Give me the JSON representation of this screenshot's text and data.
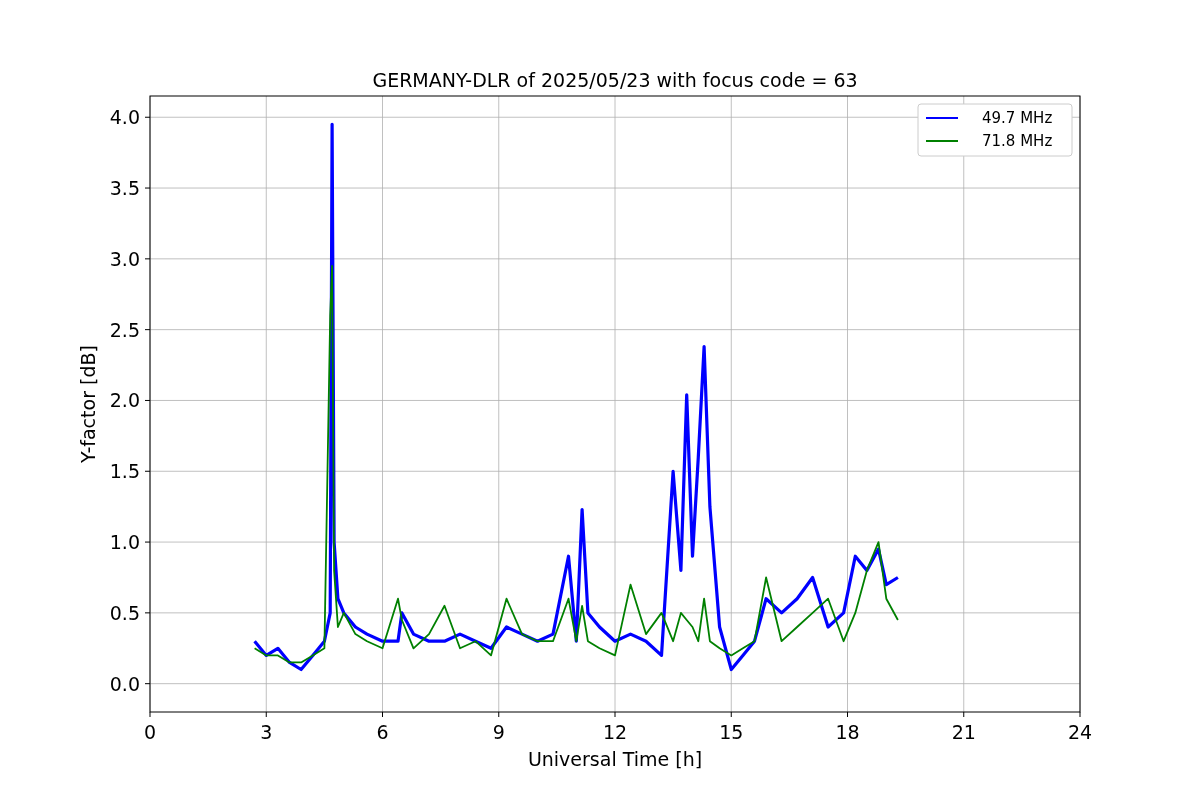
{
  "chart_data": {
    "type": "line",
    "title": "GERMANY-DLR of 2025/05/23 with focus code = 63",
    "xlabel": "Universal Time [h]",
    "ylabel": "Y-factor [dB]",
    "x": [
      2.7,
      3.0,
      3.3,
      3.6,
      3.9,
      4.2,
      4.5,
      4.65,
      4.7,
      4.75,
      4.85,
      5.0,
      5.3,
      5.6,
      6.0,
      6.4,
      6.5,
      6.8,
      7.2,
      7.6,
      8.0,
      8.4,
      8.8,
      9.2,
      9.6,
      10.0,
      10.4,
      10.8,
      11.0,
      11.15,
      11.3,
      11.6,
      12.0,
      12.4,
      12.8,
      13.2,
      13.5,
      13.7,
      13.85,
      14.0,
      14.15,
      14.3,
      14.45,
      14.7,
      15.0,
      15.3,
      15.6,
      15.9,
      16.3,
      16.7,
      17.1,
      17.5,
      17.9,
      18.2,
      18.5,
      18.8,
      19.0,
      19.3
    ],
    "series": [
      {
        "name": "49.7 MHz",
        "color": "#0000ff",
        "values": [
          0.3,
          0.2,
          0.25,
          0.15,
          0.1,
          0.2,
          0.3,
          0.5,
          3.95,
          1.0,
          0.6,
          0.5,
          0.4,
          0.35,
          0.3,
          0.3,
          0.5,
          0.35,
          0.3,
          0.3,
          0.35,
          0.3,
          0.25,
          0.4,
          0.35,
          0.3,
          0.35,
          0.9,
          0.3,
          1.23,
          0.5,
          0.4,
          0.3,
          0.35,
          0.3,
          0.2,
          1.5,
          0.8,
          2.04,
          0.9,
          1.6,
          2.38,
          1.25,
          0.4,
          0.1,
          0.2,
          0.3,
          0.6,
          0.5,
          0.6,
          0.75,
          0.4,
          0.5,
          0.9,
          0.8,
          0.95,
          0.7,
          0.75
        ]
      },
      {
        "name": "71.8 MHz",
        "color": "#008000",
        "values": [
          0.25,
          0.2,
          0.2,
          0.15,
          0.15,
          0.2,
          0.25,
          2.6,
          2.95,
          0.8,
          0.4,
          0.5,
          0.35,
          0.3,
          0.25,
          0.6,
          0.45,
          0.25,
          0.35,
          0.55,
          0.25,
          0.3,
          0.2,
          0.6,
          0.35,
          0.3,
          0.3,
          0.6,
          0.3,
          0.55,
          0.3,
          0.25,
          0.2,
          0.7,
          0.35,
          0.5,
          0.3,
          0.5,
          0.45,
          0.4,
          0.3,
          0.6,
          0.3,
          0.25,
          0.2,
          0.25,
          0.3,
          0.75,
          0.3,
          0.4,
          0.5,
          0.6,
          0.3,
          0.5,
          0.8,
          1.0,
          0.6,
          0.45
        ]
      }
    ],
    "grid": true,
    "legend": true,
    "xlim": [
      0,
      24
    ],
    "ylim": [
      -0.2,
      4.15
    ],
    "xticks": [
      0,
      3,
      6,
      9,
      12,
      15,
      18,
      21,
      24
    ],
    "yticks": [
      {
        "value": 0,
        "label": "0.0"
      },
      {
        "value": 0.5,
        "label": "0.5"
      },
      {
        "value": 1,
        "label": "1.0"
      },
      {
        "value": 1.5,
        "label": "1.5"
      },
      {
        "value": 2,
        "label": "2.0"
      },
      {
        "value": 2.5,
        "label": "2.5"
      },
      {
        "value": 3,
        "label": "3.0"
      },
      {
        "value": 3.5,
        "label": "3.5"
      },
      {
        "value": 4,
        "label": "4.0"
      }
    ]
  }
}
